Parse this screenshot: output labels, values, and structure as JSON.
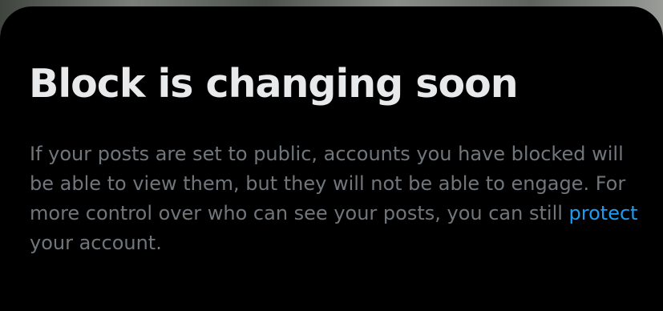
{
  "sheet": {
    "title": "Block is changing soon",
    "body_before_link": "If your posts are set to public, accounts you have blocked will be able to view them, but they will not be able to engage. For more control over who can see your posts, you can still ",
    "link_text": "protect",
    "body_after_link": " your account."
  },
  "colors": {
    "background": "#000000",
    "title": "#e7e9ea",
    "body": "#71767b",
    "link": "#1d9bf0"
  }
}
